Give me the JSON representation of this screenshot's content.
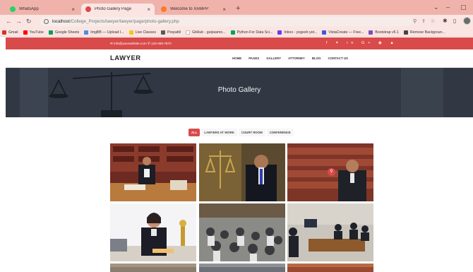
{
  "browser": {
    "tabs": [
      {
        "title": "WhatsApp",
        "active": false,
        "icon": "whatsapp-icon",
        "color": "#25d366"
      },
      {
        "title": "Photo Gallery Page",
        "active": true,
        "icon": "scales-icon",
        "color": "#d94a4a"
      },
      {
        "title": "Welcome to XAMPP",
        "active": false,
        "icon": "xampp-icon",
        "color": "#fb7a24"
      }
    ],
    "url_host": "localhost",
    "url_path": "/College_Projects/lawyer/lawyer/page/photo-gallery.php",
    "bookmarks": [
      {
        "label": "Gmail",
        "color": "#d93025"
      },
      {
        "label": "YouTube",
        "color": "#ff0000"
      },
      {
        "label": "Google Sheets",
        "color": "#0f9d58"
      },
      {
        "label": "ImgBB — Upload I...",
        "color": "#4a90e2"
      },
      {
        "label": "Live Classes",
        "color": "#f5c518"
      },
      {
        "label": "Prepattil",
        "color": "#5a5a5a"
      },
      {
        "label": "GitHub - gulpsamo...",
        "color": "#ffffff"
      },
      {
        "label": "Python For Data Sci...",
        "color": "#00a651"
      },
      {
        "label": "Inbox - yogesh-yet...",
        "color": "#6a3de8"
      },
      {
        "label": "VistaCreate — Free...",
        "color": "#3b5bdb"
      },
      {
        "label": "Bootstrap v5.1",
        "color": "#7952b3"
      },
      {
        "label": "Remove Backgroun...",
        "color": "#444444"
      }
    ]
  },
  "site": {
    "top_contact": "✉ info@yourwebsite.com    ✆ 123-456-7870",
    "social_icons": "f  ✦  in  G+  ◉  ▲",
    "logo": "LAWYER",
    "menu": [
      "HOME",
      "PAGES",
      "GALLERY",
      "ATTORNEY",
      "BLOG",
      "CONTACT US"
    ],
    "hero_title": "Photo Gallery",
    "filters": [
      {
        "label": "ALL",
        "active": true
      },
      {
        "label": "LAWYERS AT WORK",
        "active": false
      },
      {
        "label": "COURT ROOM",
        "active": false
      },
      {
        "label": "CONFERENCE",
        "active": false
      }
    ]
  },
  "colors": {
    "accent": "#d94a4a",
    "tabbar": "#f0b3ac",
    "hero": "#313844"
  }
}
